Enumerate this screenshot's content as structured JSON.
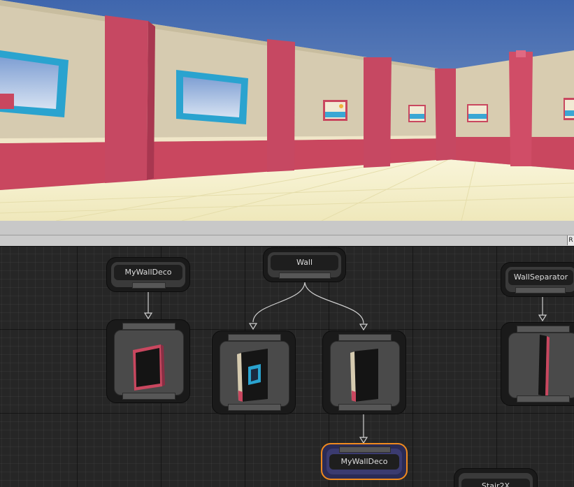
{
  "viewport": {
    "label": "3D scene view"
  },
  "toolbar": {
    "right_button": "R"
  },
  "graph": {
    "nodes": {
      "wall": {
        "label": "Wall"
      },
      "my_wall_deco_top": {
        "label": "MyWallDeco"
      },
      "wall_separator": {
        "label": "WallSeparator"
      },
      "my_wall_deco_selected": {
        "label": "MyWallDeco"
      },
      "stair_partial": {
        "label": "Stair2X"
      }
    }
  },
  "colors": {
    "wall_beige": "#d6cbb0",
    "wall_pink": "#c9475f",
    "frame_blue": "#2aa3cf",
    "floor": "#f6f1c8",
    "sky": "#4b73b8",
    "selection_outline": "#f08a1e"
  }
}
